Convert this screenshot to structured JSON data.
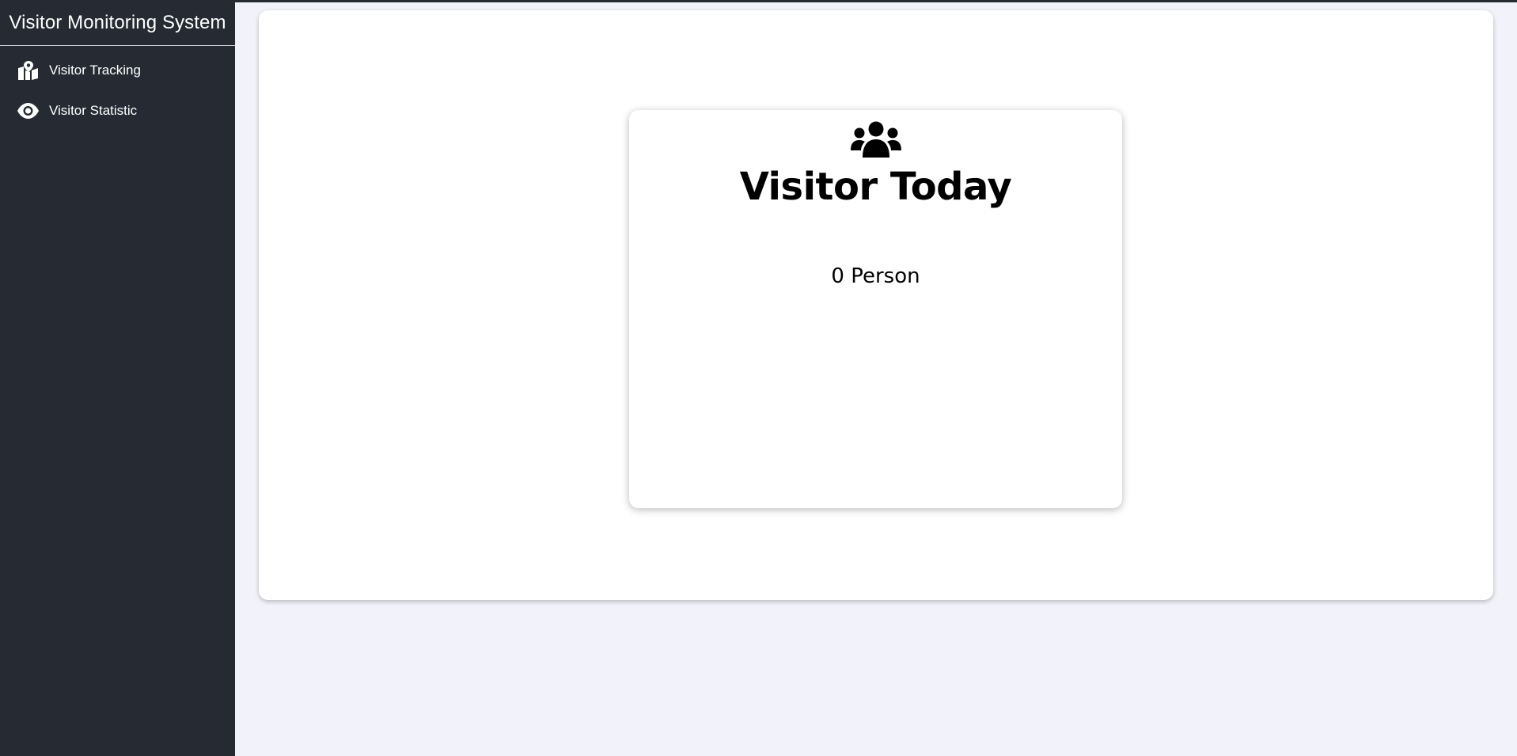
{
  "app": {
    "title": "Visitor Monitoring System"
  },
  "sidebar": {
    "items": [
      {
        "label": "Visitor Tracking",
        "icon": "map-location-icon"
      },
      {
        "label": "Visitor Statistic",
        "icon": "eye-icon"
      }
    ]
  },
  "dashboard": {
    "card_title": "Visitor Today",
    "card_icon": "users-icon",
    "count_text": "0 Person"
  },
  "colors": {
    "sidebar_bg": "#262b33",
    "page_bg": "#f2f3fa",
    "card_bg": "#ffffff",
    "text": "#000000"
  }
}
